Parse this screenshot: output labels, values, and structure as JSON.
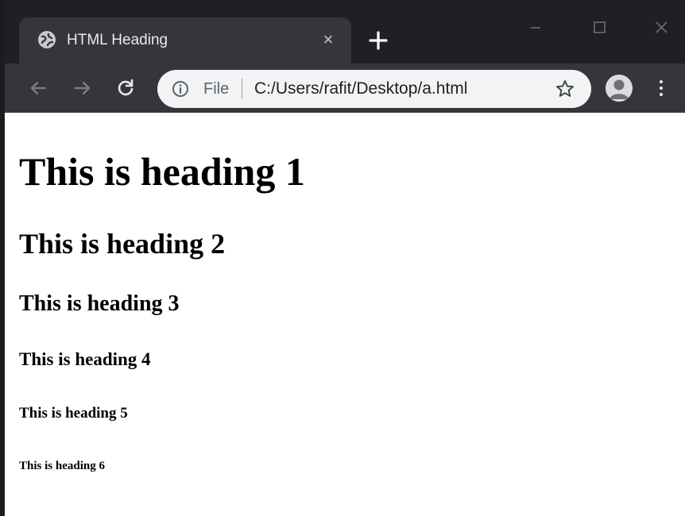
{
  "browser": {
    "tab": {
      "title": "HTML Heading",
      "favicon_icon": "globe-icon",
      "close_glyph": "×"
    },
    "new_tab_icon": "plus-icon",
    "window_controls": [
      "minimize-icon",
      "maximize-icon",
      "close-icon"
    ],
    "toolbar": {
      "back_icon": "arrow-left-icon",
      "forward_icon": "arrow-right-icon",
      "reload_icon": "reload-icon",
      "omnibox": {
        "info_icon": "info-icon",
        "scheme_label": "File",
        "url": "C:/Users/rafit/Desktop/a.html",
        "bookmark_icon": "star-icon"
      },
      "profile_icon": "avatar-icon",
      "menu_icon": "more-vert-icon"
    },
    "colors": {
      "tabstrip": "#1f2023",
      "toolbar": "#35363a",
      "omnibox": "#f1f3f4",
      "page": "#ffffff"
    }
  },
  "page": {
    "headings": {
      "h1": "This is heading 1",
      "h2": "This is heading 2",
      "h3": "This is heading 3",
      "h4": "This is heading 4",
      "h5": "This is heading 5",
      "h6": "This is heading 6"
    }
  }
}
